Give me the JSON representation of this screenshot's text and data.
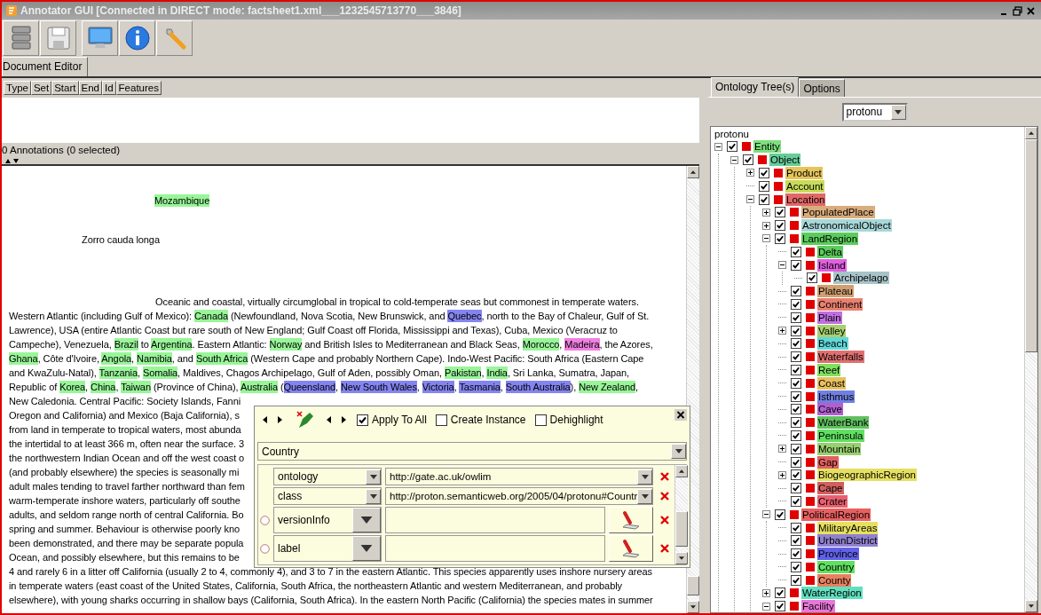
{
  "window": {
    "title": "Annotator GUI [Connected in DIRECT mode: factsheet1.xml___1232545713770___3846]"
  },
  "tabs": [
    {
      "label": "Document Editor",
      "selected": true
    }
  ],
  "annotation_table": {
    "columns": [
      "Type",
      "Set",
      "Start",
      "End",
      "Id",
      "Features"
    ],
    "status": "0 Annotations (0 selected)"
  },
  "document": {
    "lines": [
      {
        "kind": "label",
        "segments": [
          {
            "text": "Mozambique",
            "color": "#98f598"
          }
        ]
      },
      {
        "kind": "caption",
        "segments": [
          {
            "text": "Zorro cauda longa"
          }
        ]
      },
      {
        "kind": "lead",
        "segments": [
          {
            "text": "Oceanic and coastal, virtually circumglobal in tropical to cold-temperate seas but commonest in temperate waters."
          }
        ]
      },
      {
        "kind": "body",
        "segments": [
          {
            "text": "Western Atlantic (including Gulf of Mexico): "
          },
          {
            "text": "Canada",
            "color": "#98f598"
          },
          {
            "text": " (Newfoundland, Nova Scotia, New Brunswick, and "
          },
          {
            "text": "Quebec",
            "color": "#8484f0"
          },
          {
            "text": ", north to the Bay of Chaleur, Gulf of St."
          }
        ]
      },
      {
        "kind": "body",
        "segments": [
          {
            "text": "Lawrence), USA (entire Atlantic Coast but rare south of New England; Gulf Coast off Florida, Mississippi and Texas), Cuba, Mexico (Veracruz to"
          }
        ]
      },
      {
        "kind": "body",
        "segments": [
          {
            "text": "Campeche), Venezuela, "
          },
          {
            "text": "Brazil",
            "color": "#98f598"
          },
          {
            "text": " to "
          },
          {
            "text": "Argentina",
            "color": "#98f598"
          },
          {
            "text": ". Eastern Atlantic: "
          },
          {
            "text": "Norway",
            "color": "#98f598"
          },
          {
            "text": " and British Isles to Mediterranean and Black Seas, "
          },
          {
            "text": "Morocco",
            "color": "#98f598"
          },
          {
            "text": ", "
          },
          {
            "text": "Madeira",
            "color": "#f080e0"
          },
          {
            "text": ", the Azores,"
          }
        ]
      },
      {
        "kind": "body",
        "segments": [
          {
            "text": "Ghana",
            "color": "#98f598"
          },
          {
            "text": ", Côte d'Ivoire, "
          },
          {
            "text": "Angola",
            "color": "#98f598"
          },
          {
            "text": ", "
          },
          {
            "text": "Namibia",
            "color": "#98f598"
          },
          {
            "text": ", and "
          },
          {
            "text": "South Africa",
            "color": "#98f598"
          },
          {
            "text": " (Western Cape and probably Northern Cape). Indo-West Pacific: South Africa (Eastern Cape"
          }
        ]
      },
      {
        "kind": "body",
        "segments": [
          {
            "text": "and KwaZulu-Natal), "
          },
          {
            "text": "Tanzania",
            "color": "#98f598"
          },
          {
            "text": ", "
          },
          {
            "text": "Somalia",
            "color": "#98f598"
          },
          {
            "text": ", Maldives, Chagos Archipelago, Gulf of Aden, possibly Oman, "
          },
          {
            "text": "Pakistan",
            "color": "#98f598"
          },
          {
            "text": ", "
          },
          {
            "text": "India",
            "color": "#98f598"
          },
          {
            "text": ", Sri Lanka, Sumatra, Japan,"
          }
        ]
      },
      {
        "kind": "body",
        "segments": [
          {
            "text": "Republic of "
          },
          {
            "text": "Korea",
            "color": "#98f598"
          },
          {
            "text": ", "
          },
          {
            "text": "China",
            "color": "#98f598"
          },
          {
            "text": ", "
          },
          {
            "text": "Taiwan",
            "color": "#98f598"
          },
          {
            "text": " (Province of China), "
          },
          {
            "text": "Australia",
            "color": "#98f598"
          },
          {
            "text": " ("
          },
          {
            "text": "Queensland",
            "color": "#8484f0"
          },
          {
            "text": ", "
          },
          {
            "text": "New South Wales",
            "color": "#8484f0"
          },
          {
            "text": ", "
          },
          {
            "text": "Victoria",
            "color": "#8484f0"
          },
          {
            "text": ", "
          },
          {
            "text": "Tasmania",
            "color": "#8484f0"
          },
          {
            "text": ", "
          },
          {
            "text": "South Australia",
            "color": "#8484f0"
          },
          {
            "text": "), "
          },
          {
            "text": "New Zealand",
            "color": "#98f598"
          },
          {
            "text": ","
          }
        ]
      },
      {
        "kind": "body",
        "segments": [
          {
            "text": "New Caledonia. Central Pacific: Society Islands, Fanni"
          }
        ]
      },
      {
        "kind": "body",
        "segments": [
          {
            "text": "Oregon and California) and Mexico (Baja California), s"
          }
        ]
      },
      {
        "kind": "body",
        "segments": [
          {
            "text": "from land in temperate to tropical waters, most abunda"
          }
        ]
      },
      {
        "kind": "body",
        "segments": [
          {
            "text": "the intertidal to at least 366 m, often near the surface. 3"
          }
        ]
      },
      {
        "kind": "body",
        "segments": [
          {
            "text": "the northwestern Indian Ocean and off the west coast o"
          }
        ]
      },
      {
        "kind": "body",
        "segments": [
          {
            "text": "(and probably elsewhere) the species is seasonally mi"
          }
        ]
      },
      {
        "kind": "body",
        "segments": [
          {
            "text": "adult males tending to travel farther northward than fem"
          }
        ]
      },
      {
        "kind": "body",
        "segments": [
          {
            "text": "warm-temperate inshore waters, particularly off southe"
          }
        ]
      },
      {
        "kind": "body",
        "segments": [
          {
            "text": "adults, and seldom range north of central California. Bo"
          }
        ]
      },
      {
        "kind": "body",
        "segments": [
          {
            "text": "spring and summer. Behaviour is otherwise poorly kno"
          }
        ]
      },
      {
        "kind": "body",
        "segments": [
          {
            "text": "been demonstrated, and there may be separate popula"
          }
        ]
      },
      {
        "kind": "body",
        "segments": [
          {
            "text": "Ocean, and possibly elsewhere, but this remains to be"
          }
        ]
      },
      {
        "kind": "body",
        "segments": [
          {
            "text": "4 and rarely 6 in a litter off California (usually 2 to 4, commonly 4), and 3 to 7 in the eastern Atlantic. This species apparently uses inshore nursery areas"
          }
        ]
      },
      {
        "kind": "body",
        "segments": [
          {
            "text": "in temperate waters (east coast of the United States, California, South Africa, the northeastern Atlantic and western Mediterranean, and probably"
          }
        ]
      },
      {
        "kind": "body",
        "segments": [
          {
            "text": "elsewhere), with young sharks occurring in shallow bays (California, South Africa). In the eastern North Pacific (California) the species mates in summer"
          }
        ]
      }
    ]
  },
  "annotation_editor": {
    "options": [
      {
        "label": "Apply To All",
        "checked": true
      },
      {
        "label": "Create Instance",
        "checked": false
      },
      {
        "label": "Dehighlight",
        "checked": false
      }
    ],
    "type": "Country",
    "features": [
      {
        "kind": "select",
        "name": "ontology",
        "value": "http://gate.ac.uk/owlim"
      },
      {
        "kind": "select",
        "name": "class",
        "value": "http://proton.semanticweb.org/2005/04/protonu#Countr"
      },
      {
        "kind": "text",
        "name": "versionInfo",
        "selected": false
      },
      {
        "kind": "text",
        "name": "label",
        "selected": false
      }
    ]
  },
  "ontology_panel": {
    "tabs": [
      {
        "label": "Ontology Tree(s)",
        "selected": true
      },
      {
        "label": "Options",
        "selected": false
      }
    ],
    "ontology": "protonu",
    "tree": {
      "label": "protonu",
      "children": [
        {
          "label": "Entity",
          "color": "#7ee07e",
          "checked": true,
          "expanded": true,
          "children": [
            {
              "label": "Object",
              "color": "#66cc99",
              "checked": true,
              "expanded": true,
              "children": [
                {
                  "label": "Product",
                  "color": "#e6c45a",
                  "checked": true,
                  "expanded": false
                },
                {
                  "label": "Account",
                  "color": "#c8dc5a",
                  "checked": true
                },
                {
                  "label": "Location",
                  "color": "#e06868",
                  "checked": true,
                  "expanded": true,
                  "children": [
                    {
                      "label": "PopulatedPlace",
                      "color": "#d8ac7c",
                      "checked": true,
                      "expanded": false
                    },
                    {
                      "label": "AstronomicalObject",
                      "color": "#a8d8d8",
                      "checked": true,
                      "expanded": false
                    },
                    {
                      "label": "LandRegion",
                      "color": "#5ccc5c",
                      "checked": true,
                      "expanded": true,
                      "children": [
                        {
                          "label": "Delta",
                          "color": "#5ccc5c",
                          "checked": true
                        },
                        {
                          "label": "Island",
                          "color": "#e060e0",
                          "checked": true,
                          "expanded": true,
                          "children": [
                            {
                              "label": "Archipelago",
                              "color": "#a8c4c8",
                              "checked": true
                            }
                          ]
                        },
                        {
                          "label": "Plateau",
                          "color": "#d0a070",
                          "checked": true
                        },
                        {
                          "label": "Continent",
                          "color": "#e88070",
                          "checked": true
                        },
                        {
                          "label": "Plain",
                          "color": "#c070e0",
                          "checked": true
                        },
                        {
                          "label": "Valley",
                          "color": "#a8d070",
                          "checked": true,
                          "expanded": false
                        },
                        {
                          "label": "Beach",
                          "color": "#60d8d8",
                          "checked": true
                        },
                        {
                          "label": "Waterfalls",
                          "color": "#e07070",
                          "checked": true
                        },
                        {
                          "label": "Reef",
                          "color": "#80e060",
                          "checked": true
                        },
                        {
                          "label": "Coast",
                          "color": "#e8c060",
                          "checked": true
                        },
                        {
                          "label": "Isthmus",
                          "color": "#7080e0",
                          "checked": true
                        },
                        {
                          "label": "Cave",
                          "color": "#b060d0",
                          "checked": true
                        },
                        {
                          "label": "WaterBank",
                          "color": "#60c060",
                          "checked": true
                        },
                        {
                          "label": "Peninsula",
                          "color": "#60e060",
                          "checked": true
                        },
                        {
                          "label": "Mountain",
                          "color": "#98d070",
                          "checked": true,
                          "expanded": false
                        },
                        {
                          "label": "Gap",
                          "color": "#e06060",
                          "checked": true
                        },
                        {
                          "label": "BiogeographicRegion",
                          "color": "#e6e060",
                          "checked": true,
                          "expanded": false
                        },
                        {
                          "label": "Cape",
                          "color": "#d06060",
                          "checked": true
                        },
                        {
                          "label": "Crater",
                          "color": "#e86070",
                          "checked": true
                        }
                      ]
                    },
                    {
                      "label": "PoliticalRegion",
                      "color": "#e86060",
                      "checked": true,
                      "expanded": true,
                      "children": [
                        {
                          "label": "MilitaryAreas",
                          "color": "#e6e060",
                          "checked": true
                        },
                        {
                          "label": "UrbanDistrict",
                          "color": "#9080d0",
                          "checked": true
                        },
                        {
                          "label": "Province",
                          "color": "#6060e8",
                          "checked": true
                        },
                        {
                          "label": "Country",
                          "color": "#60e060",
                          "checked": true
                        },
                        {
                          "label": "County",
                          "color": "#e88060",
                          "checked": true
                        }
                      ]
                    },
                    {
                      "label": "WaterRegion",
                      "color": "#60e0c0",
                      "checked": true,
                      "expanded": false
                    },
                    {
                      "label": "Facility",
                      "color": "#e878d8",
                      "checked": true,
                      "expanded": true
                    }
                  ]
                }
              ]
            }
          ]
        }
      ]
    }
  }
}
